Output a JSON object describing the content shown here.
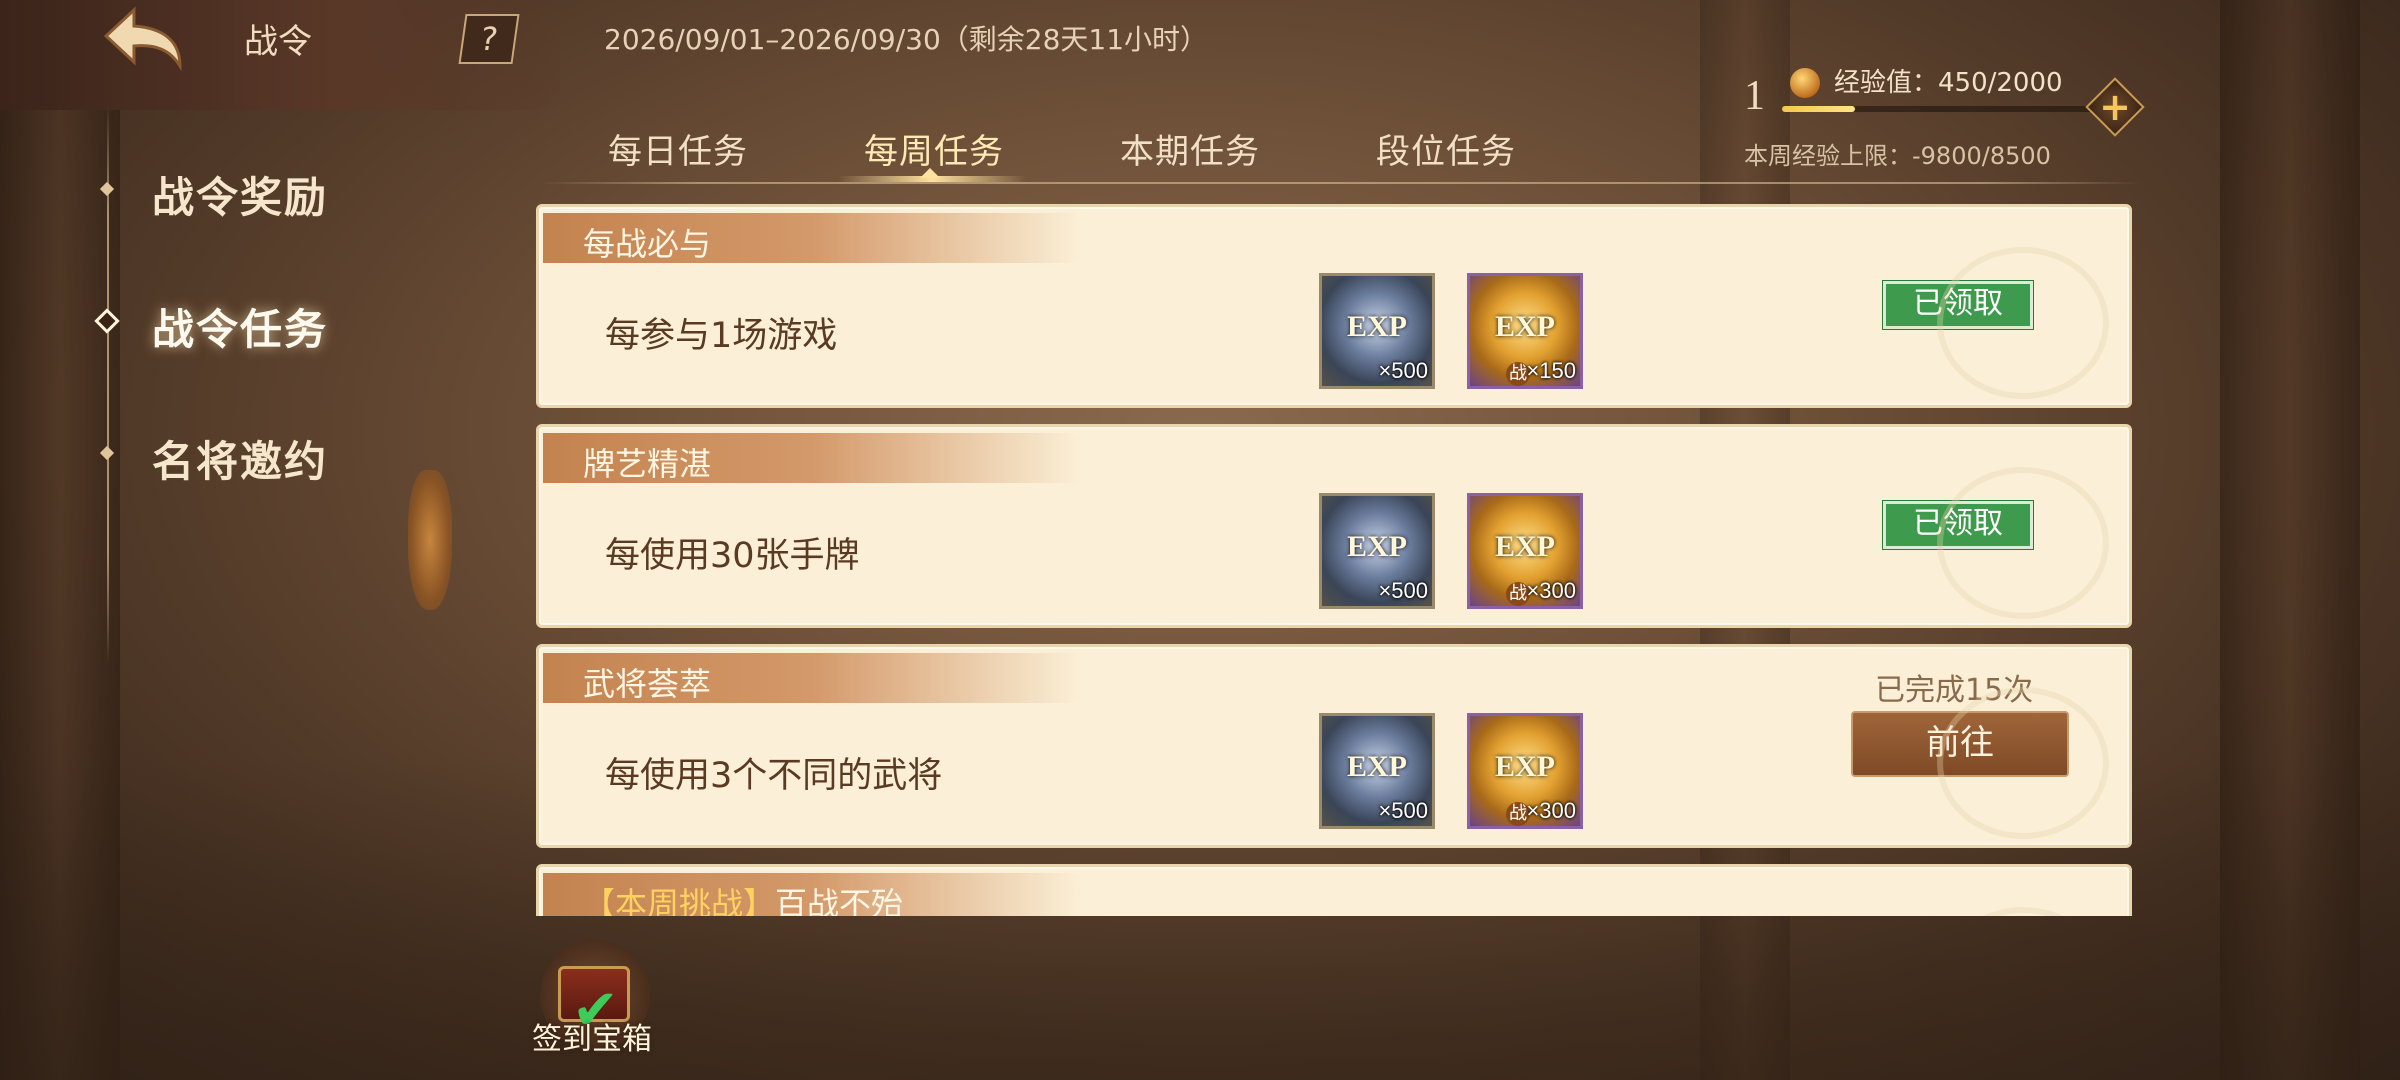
{
  "header": {
    "title": "战令",
    "help_symbol": "?",
    "date_range": "2026/09/01–2026/09/30（剩余28天11小时）"
  },
  "exp": {
    "level": "1",
    "label": "经验值：450/2000",
    "current": 450,
    "max": 2000,
    "plus_symbol": "+",
    "weekly_cap": "本周经验上限：-9800/8500"
  },
  "sidebar": {
    "items": [
      {
        "label": "战令奖励",
        "active": false
      },
      {
        "label": "战令任务",
        "active": true
      },
      {
        "label": "名将邀约",
        "active": false
      }
    ]
  },
  "tabs": [
    {
      "label": "每日任务",
      "active": false
    },
    {
      "label": "每周任务",
      "active": true
    },
    {
      "label": "本期任务",
      "active": false
    },
    {
      "label": "段位任务",
      "active": false
    }
  ],
  "tasks": [
    {
      "title": "每战必与",
      "desc": "每参与1场游戏",
      "rewards": [
        {
          "type": "silver",
          "text": "EXP",
          "qty": "×500"
        },
        {
          "type": "gold",
          "text": "EXP",
          "badge": "战",
          "qty": "×150"
        }
      ],
      "status": "已领取"
    },
    {
      "title": "牌艺精湛",
      "desc": "每使用30张手牌",
      "rewards": [
        {
          "type": "silver",
          "text": "EXP",
          "qty": "×500"
        },
        {
          "type": "gold",
          "text": "EXP",
          "badge": "战",
          "qty": "×300"
        }
      ],
      "status": "已领取"
    },
    {
      "title": "武将荟萃",
      "desc": "每使用3个不同的武将",
      "rewards": [
        {
          "type": "silver",
          "text": "EXP",
          "qty": "×500"
        },
        {
          "type": "gold",
          "text": "EXP",
          "badge": "战",
          "qty": "×300"
        }
      ],
      "progress_text": "已完成15次",
      "action": "前往"
    },
    {
      "title_prefix": "【本周挑战】",
      "title": "百战不殆"
    }
  ],
  "sign_in": {
    "label": "签到宝箱"
  },
  "colors": {
    "claimed_green": "#3e9a4c",
    "card_bg": "#fbf0d7",
    "header_band": "#c3834f",
    "goto_brown": "#8a5430"
  }
}
